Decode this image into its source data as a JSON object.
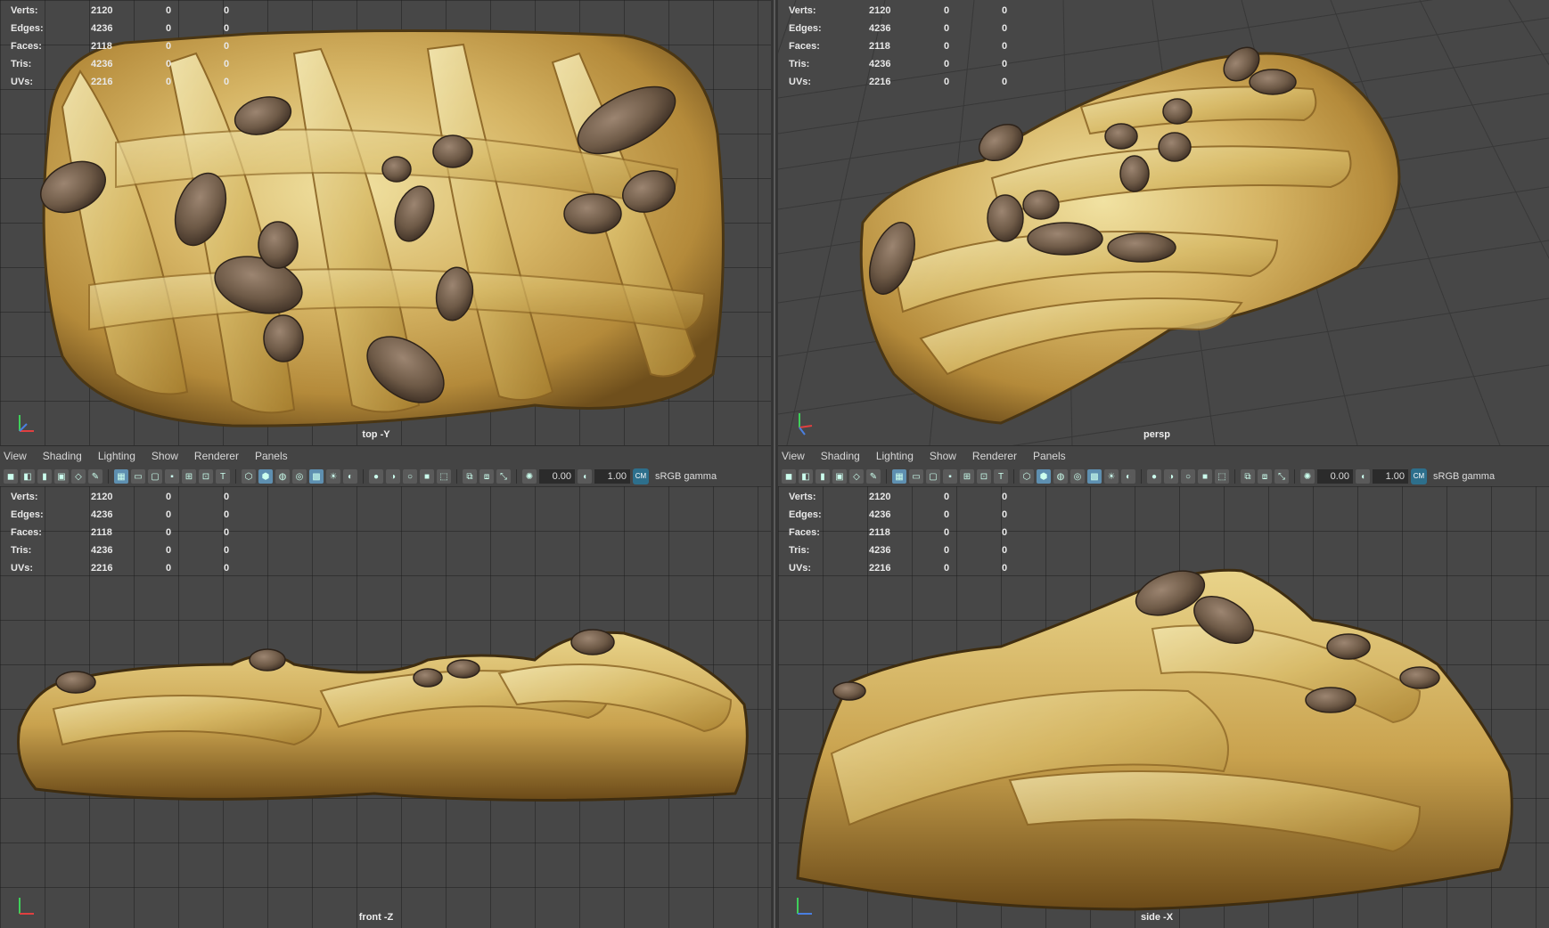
{
  "stats": {
    "rows": [
      {
        "label": "Verts:",
        "v1": "2120",
        "v2": "0",
        "v3": "0"
      },
      {
        "label": "Edges:",
        "v1": "4236",
        "v2": "0",
        "v3": "0"
      },
      {
        "label": "Faces:",
        "v1": "2118",
        "v2": "0",
        "v3": "0"
      },
      {
        "label": "Tris:",
        "v1": "4236",
        "v2": "0",
        "v3": "0"
      },
      {
        "label": "UVs:",
        "v1": "2216",
        "v2": "0",
        "v3": "0"
      }
    ]
  },
  "viewports": {
    "top_left": {
      "camera": "top -Y"
    },
    "top_right": {
      "camera": "persp"
    },
    "bottom_left": {
      "camera": "front -Z"
    },
    "bottom_right": {
      "camera": "side -X"
    }
  },
  "panel_menu": {
    "view": "View",
    "shading": "Shading",
    "lighting": "Lighting",
    "show": "Show",
    "renderer": "Renderer",
    "panels": "Panels"
  },
  "panel_toolbar": {
    "exposure": "0.00",
    "gamma": "1.00",
    "color_space": "sRGB gamma"
  },
  "colors": {
    "viewport_bg": "#474747",
    "crust": "#c9a452",
    "nut": "#6e5a47",
    "active_tool": "#5e8fb0"
  }
}
